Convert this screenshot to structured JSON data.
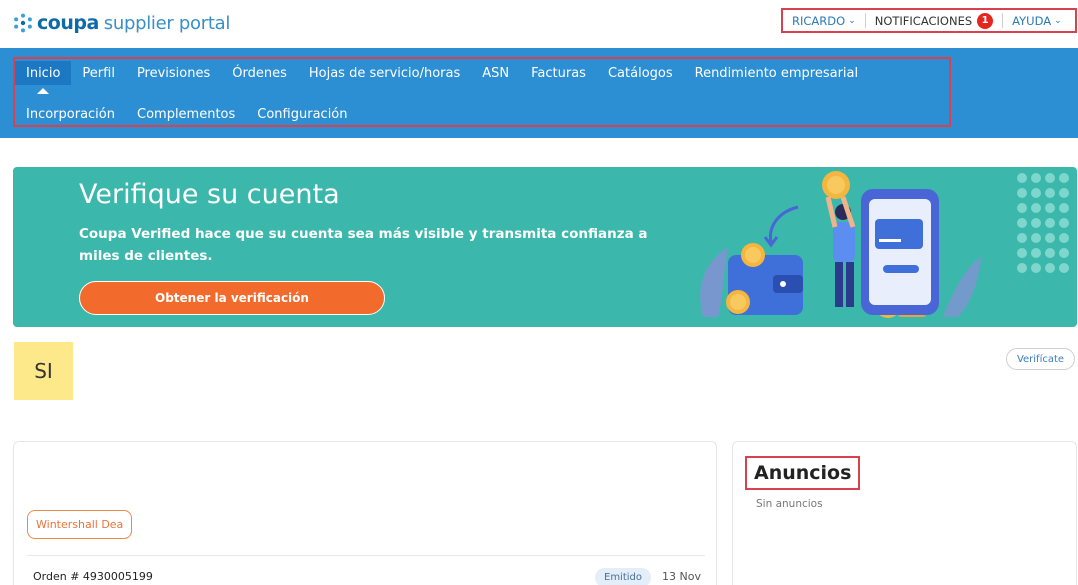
{
  "header": {
    "logo_brand": "coupa",
    "logo_rest": "supplier portal",
    "user_menu": {
      "user": "RICARDO",
      "notifications": "NOTIFICACIONES",
      "notifications_count": "1",
      "help": "AYUDA"
    }
  },
  "nav": {
    "row1": [
      "Inicio",
      "Perfil",
      "Previsiones",
      "Órdenes",
      "Hojas de servicio/horas",
      "ASN",
      "Facturas",
      "Catálogos",
      "Rendimiento empresarial"
    ],
    "row2": [
      "Incorporación",
      "Complementos",
      "Configuración"
    ],
    "active": "Inicio"
  },
  "banner": {
    "title": "Verifique su cuenta",
    "text": "Coupa Verified hace que su cuenta sea más visible y transmita confianza a miles de clientes.",
    "button": "Obtener la verificación"
  },
  "company": {
    "initials": "SI",
    "verify_label": "Verifícate"
  },
  "orders_card": {
    "tag": "Wintershall Dea",
    "order_label": "Orden # 4930005199",
    "status": "Emitido",
    "date": "13 Nov"
  },
  "announcements": {
    "title": "Anuncios",
    "empty": "Sin anuncios"
  },
  "colors": {
    "nav_bg": "#2d8fd3",
    "banner_bg": "#3bb8ab",
    "cta": "#f26b2c",
    "highlight_border": "#d9414e",
    "badge": "#e3261f"
  }
}
